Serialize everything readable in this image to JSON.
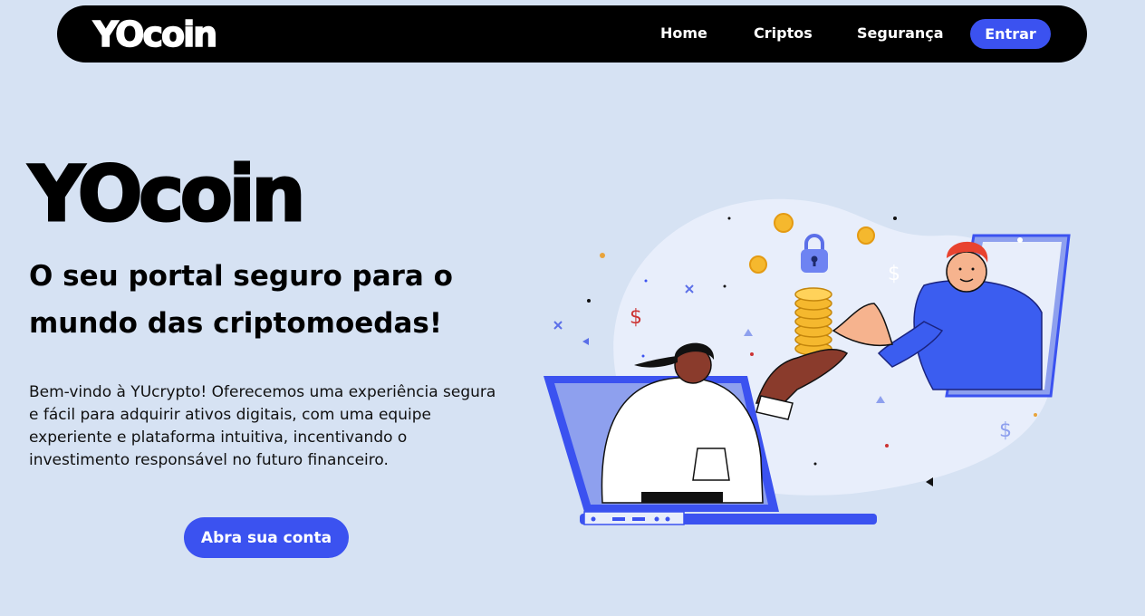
{
  "navbar": {
    "logo": "YOcoin",
    "links": [
      "Home",
      "Criptos",
      "Segurança"
    ],
    "login_button": "Entrar"
  },
  "hero": {
    "title": "YOcoin",
    "subtitle": "O seu portal seguro para o mundo das criptomoedas!",
    "description": "Bem-vindo à YUcrypto! Oferecemos uma experiência segura e fácil para adquirir ativos digitais, com uma equipe experiente e plataforma intuitiva, incentivando o investimento responsável no futuro financeiro.",
    "cta_button": "Abra sua conta"
  },
  "colors": {
    "background": "#d6e2f3",
    "navbar": "#000000",
    "accent": "#3b52f0"
  },
  "illustration": {
    "icons": [
      "laptop-icon",
      "phone-icon",
      "coin-stack-icon",
      "padlock-icon",
      "dollar-sign-icon"
    ]
  }
}
